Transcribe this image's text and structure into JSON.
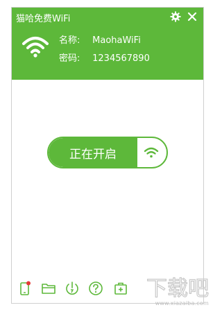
{
  "window": {
    "title": "猫哈免费WiFi"
  },
  "header": {
    "name_label": "名称:",
    "name_value": "MaohaWiFi",
    "password_label": "密码:",
    "password_value": "1234567890"
  },
  "toggle": {
    "label": "正在开启"
  },
  "colors": {
    "accent": "#5db83a",
    "bottom_icon": "#5db83a",
    "badge": "#e53935"
  },
  "icons": {
    "header": [
      "settings-icon",
      "close-icon",
      "wifi-icon"
    ],
    "toolbar": [
      "phone-icon",
      "folder-icon",
      "power-icon",
      "help-icon",
      "toolbox-icon"
    ]
  },
  "watermark": {
    "text": "下载吧",
    "url": "www.xiazaiba.com"
  }
}
